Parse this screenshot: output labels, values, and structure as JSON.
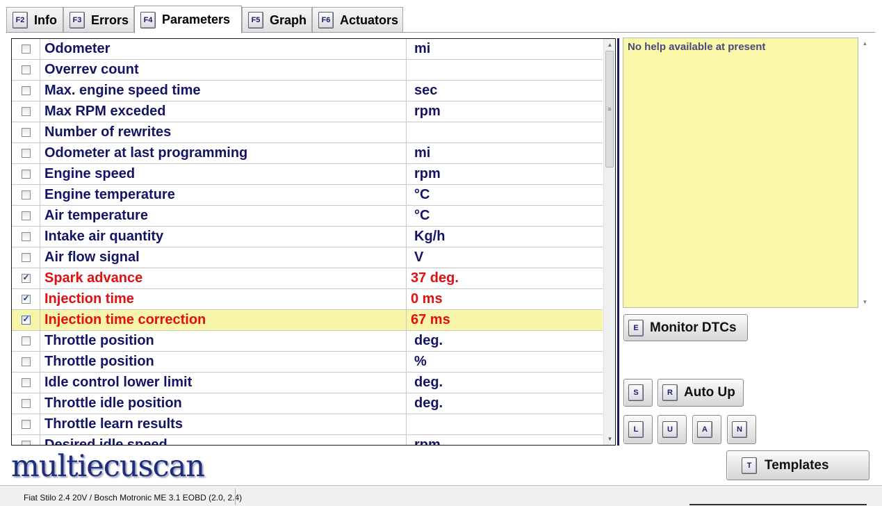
{
  "tabs": [
    {
      "key": "F2",
      "label": "Info"
    },
    {
      "key": "F3",
      "label": "Errors"
    },
    {
      "key": "F4",
      "label": "Parameters"
    },
    {
      "key": "F5",
      "label": "Graph"
    },
    {
      "key": "F6",
      "label": "Actuators"
    }
  ],
  "active_tab": "Parameters",
  "parameters": [
    {
      "name": "Odometer",
      "unit": "mi",
      "checked": false
    },
    {
      "name": "Overrev count",
      "unit": "",
      "checked": false
    },
    {
      "name": "Max. engine speed time",
      "unit": "sec",
      "checked": false
    },
    {
      "name": "Max RPM exceded",
      "unit": "rpm",
      "checked": false
    },
    {
      "name": "Number of rewrites",
      "unit": "",
      "checked": false
    },
    {
      "name": "Odometer at last programming",
      "unit": "mi",
      "checked": false
    },
    {
      "name": "Engine speed",
      "unit": "rpm",
      "checked": false
    },
    {
      "name": "Engine temperature",
      "unit": "°C",
      "checked": false
    },
    {
      "name": "Air temperature",
      "unit": "°C",
      "checked": false
    },
    {
      "name": "Intake air quantity",
      "unit": "Kg/h",
      "checked": false
    },
    {
      "name": "Air flow signal",
      "unit": "V",
      "checked": false
    },
    {
      "name": "Spark advance",
      "unit": "37 deg.",
      "checked": true
    },
    {
      "name": "Injection time",
      "unit": "0 ms",
      "checked": true
    },
    {
      "name": "Injection time correction",
      "unit": "67 ms",
      "checked": true
    },
    {
      "name": "Throttle position",
      "unit": "deg.",
      "checked": false
    },
    {
      "name": "Throttle position",
      "unit": "%",
      "checked": false
    },
    {
      "name": "Idle control lower limit",
      "unit": "deg.",
      "checked": false
    },
    {
      "name": "Throttle idle position",
      "unit": "deg.",
      "checked": false
    },
    {
      "name": "Throttle learn results",
      "unit": "",
      "checked": false
    },
    {
      "name": "Desired idle speed",
      "unit": "rpm",
      "checked": false
    }
  ],
  "selected_row": 13,
  "help": {
    "text": "No help available at present"
  },
  "buttons": {
    "monitor_dtcs": {
      "key": "E",
      "label": "Monitor DTCs"
    },
    "s": {
      "key": "S"
    },
    "auto_up": {
      "key": "R",
      "label": "Auto Up"
    },
    "l": {
      "key": "L"
    },
    "u": {
      "key": "U"
    },
    "a": {
      "key": "A"
    },
    "n": {
      "key": "N"
    },
    "templates": {
      "key": "T",
      "label": "Templates"
    }
  },
  "logo": {
    "text": "multiecuscan"
  },
  "status": {
    "vehicle": "Fiat Stilo 2.4 20V / Bosch Motronic ME 3.1 EOBD (2.0, 2.4)"
  },
  "colors": {
    "active_value": "#e01010",
    "text": "#141466",
    "selected_row": "#f8f4a8",
    "help_bg": "#f8f8a8",
    "accent": "#1a1a6e"
  }
}
